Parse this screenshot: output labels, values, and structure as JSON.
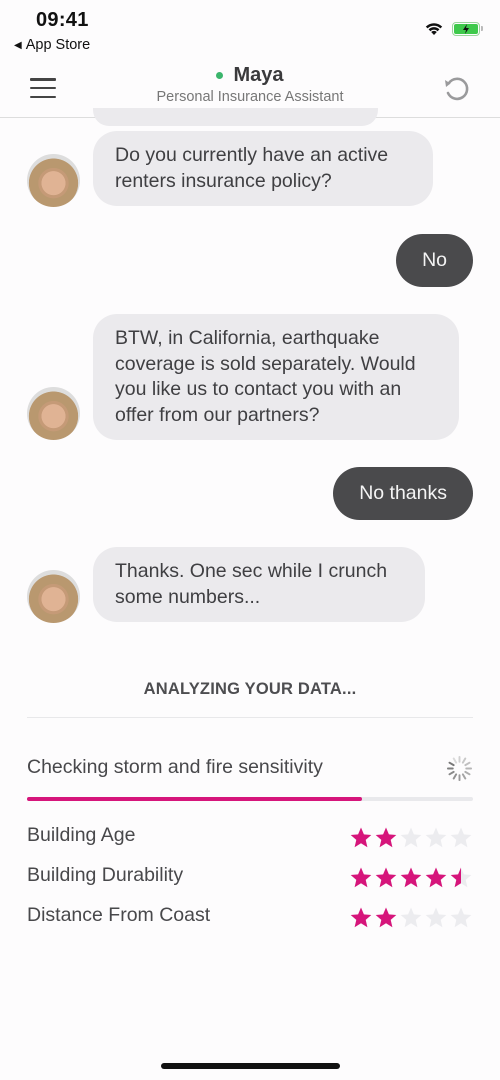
{
  "status_bar": {
    "time": "09:41",
    "back_app": "App Store",
    "icons": [
      "wifi-icon",
      "battery-charging-icon"
    ]
  },
  "header": {
    "name": "Maya",
    "subtitle": "Personal Insurance Assistant",
    "online_color": "#3bb56c",
    "menu_icon": "hamburger-menu-icon",
    "reset_icon": "restart-icon"
  },
  "messages": [
    {
      "sender": "bot",
      "text": "Do you currently have an active renters insurance policy?"
    },
    {
      "sender": "user",
      "text": "No"
    },
    {
      "sender": "bot",
      "text": "BTW, in California, earthquake coverage is sold separately. Would you like us to contact you with an offer from our partners?"
    },
    {
      "sender": "user",
      "text": "No thanks"
    },
    {
      "sender": "bot",
      "text": "Thanks. One sec while I crunch some numbers..."
    }
  ],
  "analysis": {
    "title": "ANALYZING YOUR DATA...",
    "current_step": "Checking storm and fire sensitivity",
    "progress": 0.75,
    "accent_color": "#d6157b",
    "ratings": [
      {
        "label": "Building Age",
        "stars": 2,
        "max": 5
      },
      {
        "label": "Building Durability",
        "stars": 4.5,
        "max": 5
      },
      {
        "label": "Distance From Coast",
        "stars": 2,
        "max": 5
      }
    ]
  }
}
